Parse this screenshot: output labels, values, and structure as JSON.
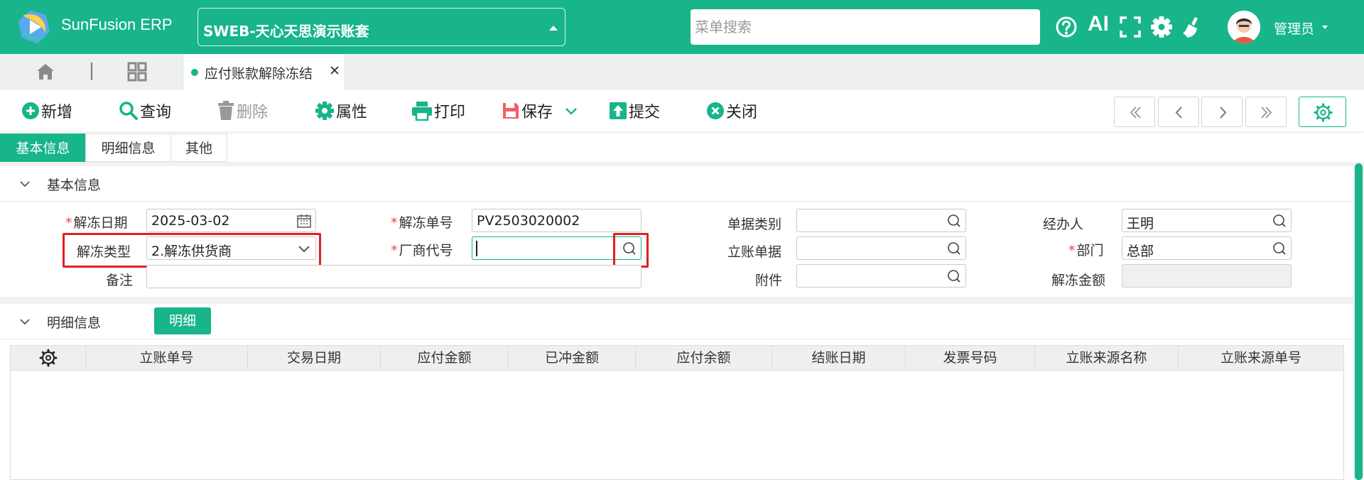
{
  "header": {
    "app_name": "SunFusion ERP",
    "account": "SWEB-天心天思演示账套",
    "menu_search_placeholder": "菜单搜索",
    "ai_label": "AI",
    "username": "管理员"
  },
  "tabs": {
    "open_tab_label": "应付账款解除冻结",
    "close_glyph": "✕"
  },
  "toolbar": {
    "add": "新增",
    "query": "查询",
    "delete": "删除",
    "properties": "属性",
    "print": "打印",
    "save": "保存",
    "submit": "提交",
    "close": "关闭"
  },
  "section_tabs": [
    "基本信息",
    "明细信息",
    "其他"
  ],
  "basic": {
    "title": "基本信息",
    "fields": {
      "unfreeze_date_label": "解冻日期",
      "unfreeze_date_value": "2025-03-02",
      "unfreeze_no_label": "解冻单号",
      "unfreeze_no_value": "PV2503020002",
      "doc_type_label": "单据类别",
      "doc_type_value": "",
      "handler_label": "经办人",
      "handler_value": "王明",
      "unfreeze_type_label": "解冻类型",
      "unfreeze_type_value": "2.解冻供货商",
      "vendor_code_label": "厂商代号",
      "vendor_code_value": "",
      "account_doc_label": "立账单据",
      "account_doc_value": "",
      "dept_label": "部门",
      "dept_value": "总部",
      "remark_label": "备注",
      "remark_value": "",
      "attachment_label": "附件",
      "attachment_value": "",
      "amount_label": "解冻金额",
      "amount_value": ""
    },
    "required_mark": "*"
  },
  "detail": {
    "title": "明细信息",
    "detail_button": "明细",
    "columns": [
      "立账单号",
      "交易日期",
      "应付金额",
      "已冲金额",
      "应付余额",
      "结账日期",
      "发票号码",
      "立账来源名称",
      "立账来源单号"
    ],
    "rows": []
  },
  "colors": {
    "brand": "#17b589",
    "required": "#e5484d",
    "highlight_box": "#e02020"
  }
}
